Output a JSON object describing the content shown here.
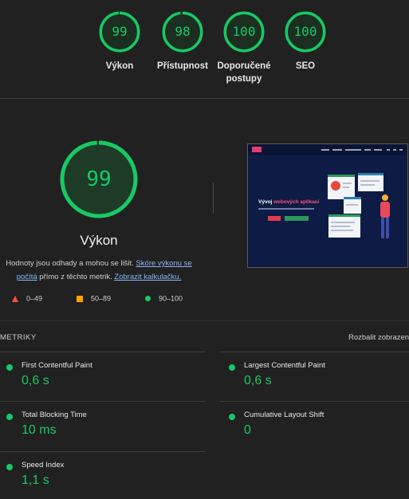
{
  "gauges": [
    {
      "score": "99",
      "label": "Výkon",
      "fraction": 0.99
    },
    {
      "score": "98",
      "label": "Přístupnost",
      "fraction": 0.98
    },
    {
      "score": "100",
      "label": "Doporučené postupy",
      "fraction": 1.0
    },
    {
      "score": "100",
      "label": "SEO",
      "fraction": 1.0
    }
  ],
  "performance": {
    "score": "99",
    "fraction": 0.99,
    "title": "Výkon",
    "desc_1": "Hodnoty jsou odhady a mohou se lišit. ",
    "link_1": "Skóre výkonu se počítá",
    "desc_2": " přímo z těchto metrik. ",
    "link_2": "Zobrazit kalkulačku."
  },
  "legend": {
    "fail": "0–49",
    "average": "50–89",
    "pass": "90–100"
  },
  "thumbnail": {
    "headline_plain": "Vývoj ",
    "headline_accent": "webových aplikací"
  },
  "metrics": {
    "title": "METRIKY",
    "expand_label": "Rozbalit zobrazení",
    "items": {
      "fcp": {
        "label": "First Contentful Paint",
        "value": "0,6 s"
      },
      "lcp": {
        "label": "Largest Contentful Paint",
        "value": "0,6 s"
      },
      "tbt": {
        "label": "Total Blocking Time",
        "value": "10 ms"
      },
      "cls": {
        "label": "Cumulative Layout Shift",
        "value": "0"
      },
      "si": {
        "label": "Speed Index",
        "value": "1,1 s"
      }
    }
  },
  "colors": {
    "pass": "#18c964",
    "average": "#ffa400",
    "fail": "#ff4e42",
    "background": "#212121"
  }
}
